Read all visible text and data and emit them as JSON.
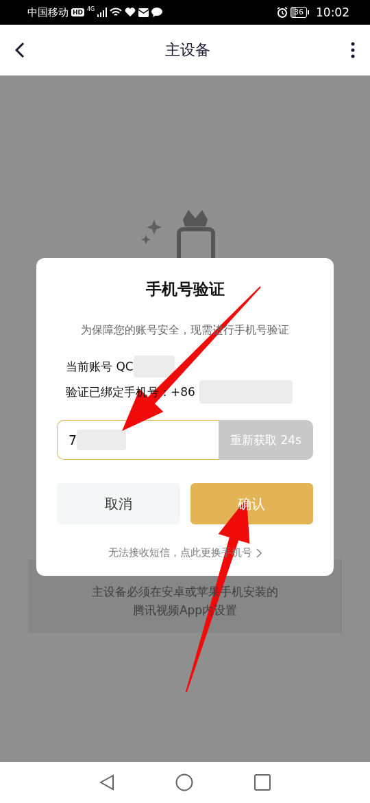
{
  "status_bar": {
    "carrier": "中国移动",
    "hd_label": "HD",
    "network": "4G",
    "battery": "36",
    "time": "10:02"
  },
  "header": {
    "title": "主设备"
  },
  "background": {
    "notice_lines": [
      "主设备必须在安卓或苹果手机安装的",
      "腾讯视频App内设置"
    ]
  },
  "dialog": {
    "title": "手机号验证",
    "subtitle": "为保障您的账号安全，现需进行手机号验证",
    "account_line": "当前账号 QC",
    "phone_line": "验证已绑定手机号：+86",
    "code_field": {
      "value": "7"
    },
    "resend_button": "重新获取 24s",
    "cancel_button": "取消",
    "confirm_button": "确认",
    "change_phone_link": "无法接收短信，点此更换手机号"
  },
  "annotation_arrows": [
    {
      "kind": "arrow"
    },
    {
      "kind": "arrow"
    }
  ]
}
